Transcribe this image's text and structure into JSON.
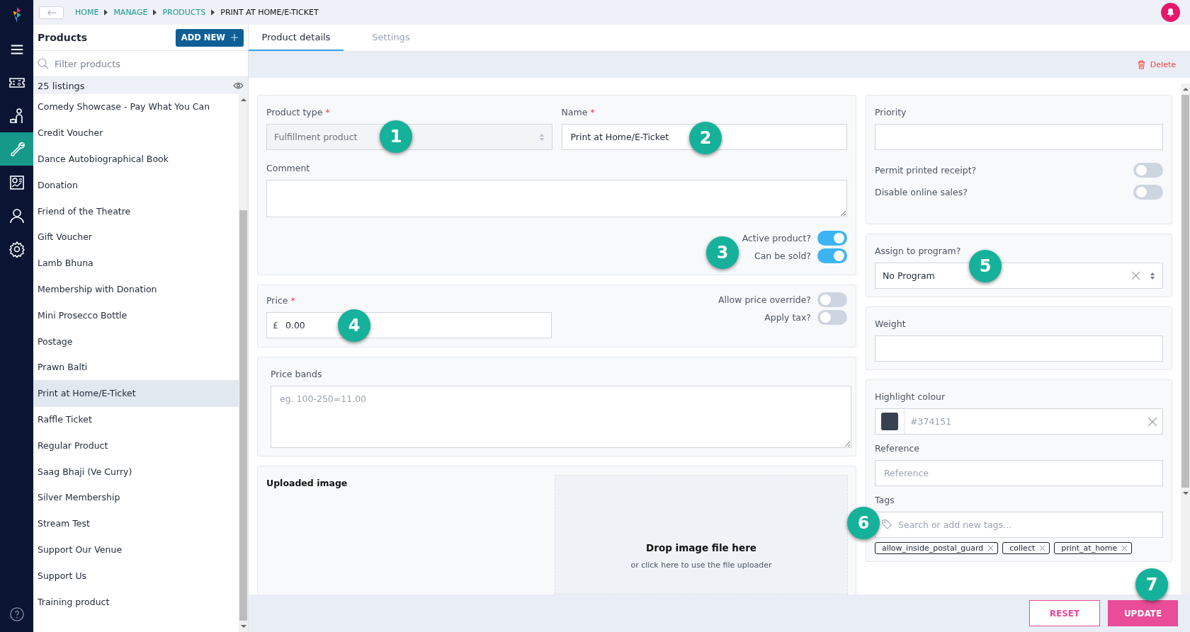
{
  "rail": [
    {
      "kind": "menu",
      "selected": false
    },
    {
      "kind": "ticket",
      "selected": false
    },
    {
      "kind": "people",
      "selected": false
    },
    {
      "kind": "tools",
      "selected": true
    },
    {
      "kind": "report",
      "selected": false
    },
    {
      "kind": "user",
      "selected": false
    },
    {
      "kind": "settings",
      "selected": false
    }
  ],
  "breadcrumb": [
    {
      "label": "HOME",
      "current": false
    },
    {
      "label": "MANAGE",
      "current": false
    },
    {
      "label": "PRODUCTS",
      "current": false
    },
    {
      "label": "PRINT AT HOME/E-TICKET",
      "current": true
    }
  ],
  "products_panel": {
    "title": "Products",
    "add_button": "ADD NEW",
    "filter_placeholder": "Filter products",
    "count": "25 listings",
    "items": [
      {
        "label": "Comedy Showcase - Pay What You Can",
        "selected": false
      },
      {
        "label": "Credit Voucher",
        "selected": false
      },
      {
        "label": "Dance Autobiographical Book",
        "selected": false
      },
      {
        "label": "Donation",
        "selected": false
      },
      {
        "label": "Friend of the Theatre",
        "selected": false
      },
      {
        "label": "Gift Voucher",
        "selected": false
      },
      {
        "label": "Lamb Bhuna",
        "selected": false
      },
      {
        "label": "Membership with Donation",
        "selected": false
      },
      {
        "label": "Mini Prosecco Bottle",
        "selected": false
      },
      {
        "label": "Postage",
        "selected": false
      },
      {
        "label": "Prawn Balti",
        "selected": false
      },
      {
        "label": "Print at Home/E-Ticket",
        "selected": true
      },
      {
        "label": "Raffle Ticket",
        "selected": false
      },
      {
        "label": "Regular Product",
        "selected": false
      },
      {
        "label": "Saag Bhaji (Ve Curry)",
        "selected": false
      },
      {
        "label": "Silver Membership",
        "selected": false
      },
      {
        "label": "Stream Test",
        "selected": false
      },
      {
        "label": "Support Our Venue",
        "selected": false
      },
      {
        "label": "Support Us",
        "selected": false
      },
      {
        "label": "Training product",
        "selected": false
      }
    ]
  },
  "tabs": [
    {
      "label": "Product details",
      "selected": true
    },
    {
      "label": "Settings",
      "selected": false
    }
  ],
  "delete_label": "Delete",
  "product_type": {
    "label": "Product type",
    "required_mark": "*",
    "value": "Fulfillment product"
  },
  "name": {
    "label": "Name",
    "required_mark": "*",
    "value": "Print at Home/E-Ticket"
  },
  "comment": {
    "label": "Comment"
  },
  "status_toggles": [
    {
      "label": "Active product?",
      "on": true
    },
    {
      "label": "Can be sold?",
      "on": true
    }
  ],
  "price": {
    "label": "Price",
    "required_mark": "*",
    "currency": "£",
    "value": "0.00"
  },
  "price_toggles": [
    {
      "label": "Allow price override?",
      "on": false
    },
    {
      "label": "Apply tax?",
      "on": false
    }
  ],
  "price_bands": {
    "label": "Price bands",
    "placeholder": "eg. 100-250=11.00"
  },
  "uploaded_image": {
    "label": "Uploaded image",
    "drop_title": "Drop image file here",
    "drop_hint": "or click here to use the file uploader"
  },
  "priority": {
    "label": "Priority"
  },
  "option_toggles": [
    {
      "label": "Permit printed receipt?",
      "on": false
    },
    {
      "label": "Disable online sales?",
      "on": false
    }
  ],
  "program": {
    "label": "Assign to program?",
    "value": "No Program"
  },
  "weight": {
    "label": "Weight"
  },
  "highlight": {
    "label": "Highlight colour",
    "value": "#374151",
    "color": "#374151"
  },
  "reference": {
    "label": "Reference",
    "placeholder": "Reference"
  },
  "tags": {
    "label": "Tags",
    "placeholder": "Search or add new tags...",
    "items": [
      "allow_inside_postal_guard",
      "collect",
      "print_at_home"
    ]
  },
  "footer_buttons": [
    {
      "label": "RESET",
      "kind": "secondary"
    },
    {
      "label": "UPDATE",
      "kind": "primary"
    }
  ],
  "callouts": [
    "1",
    "2",
    "3",
    "4",
    "5",
    "6",
    "7"
  ]
}
